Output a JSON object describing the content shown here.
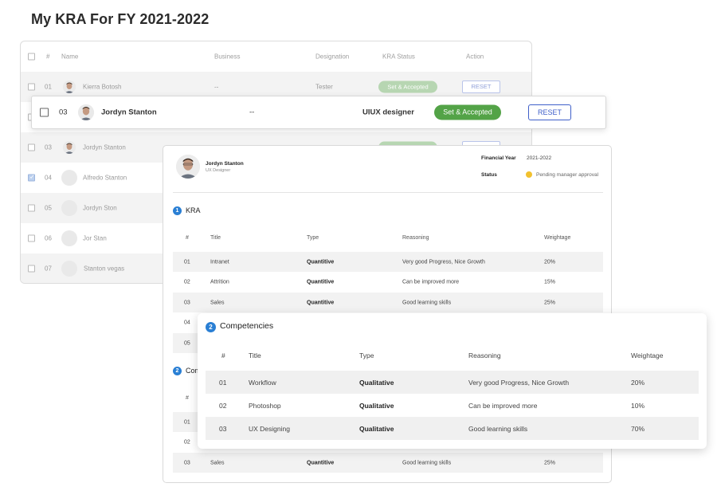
{
  "page": {
    "title": "My KRA For FY 2021-2022"
  },
  "list": {
    "headers": {
      "num": "#",
      "name": "Name",
      "business": "Business",
      "designation": "Designation",
      "status": "KRA Status",
      "action": "Action"
    },
    "rows": [
      {
        "num": "01",
        "name": "Kierra Botosh",
        "business": "--",
        "designation": "Tester",
        "status": "Set & Accepted",
        "action": "RESET"
      },
      {
        "num": "03",
        "name": "Jordyn Stanton"
      },
      {
        "num": "04",
        "name": "Alfredo Stanton"
      },
      {
        "num": "05",
        "name": "Jordyn Ston"
      },
      {
        "num": "06",
        "name": "Jor Stan"
      },
      {
        "num": "07",
        "name": "Stanton vegas"
      }
    ]
  },
  "highlight_row": {
    "num": "03",
    "name": "Jordyn Stanton",
    "business": "--",
    "designation": "UIUX designer",
    "status": "Set & Accepted",
    "action": "RESET"
  },
  "detail": {
    "profile": {
      "name": "Jordyn Stanton",
      "role": "UX Designer"
    },
    "financial_year_label": "Financial Year",
    "financial_year": "2021-2022",
    "status_label": "Status",
    "status_value": "Pending manager approval",
    "status_color": "#f2c12e",
    "kra_section": {
      "number": "1",
      "title": "KRA"
    },
    "kra_headers": {
      "num": "#",
      "title": "Title",
      "type": "Type",
      "reasoning": "Reasoning",
      "weightage": "Weightage"
    },
    "kra_rows": [
      {
        "num": "01",
        "title": "Intranet",
        "type": "Quantitive",
        "reasoning": "Very good Progress, Nice Growth",
        "weightage": "20%"
      },
      {
        "num": "02",
        "title": "Attrition",
        "type": "Quantitive",
        "reasoning": "Can be improved more",
        "weightage": "15%"
      },
      {
        "num": "03",
        "title": "Sales",
        "type": "Quantitive",
        "reasoning": "Good learning skills",
        "weightage": "25%"
      },
      {
        "num": "04"
      },
      {
        "num": "05"
      }
    ],
    "comp_section_partial": {
      "number": "2",
      "title": "Com"
    },
    "partial_rows": [
      {
        "num": "#"
      },
      {
        "num": "01"
      },
      {
        "num": "02"
      },
      {
        "num": "03",
        "title": "Sales",
        "type": "Quantitive",
        "reasoning": "Good learning skills",
        "weightage": "25%"
      }
    ]
  },
  "competencies": {
    "number": "2",
    "title": "Competencies",
    "headers": {
      "num": "#",
      "title": "Title",
      "type": "Type",
      "reasoning": "Reasoning",
      "weightage": "Weightage"
    },
    "rows": [
      {
        "num": "01",
        "title": "Workflow",
        "type": "Qualitative",
        "reasoning": "Very good Progress, Nice Growth",
        "weightage": "20%"
      },
      {
        "num": "02",
        "title": "Photoshop",
        "type": "Qualitative",
        "reasoning": "Can be improved more",
        "weightage": "10%"
      },
      {
        "num": "03",
        "title": "UX Designing",
        "type": "Qualitative",
        "reasoning": "Good learning skills",
        "weightage": "70%"
      }
    ]
  },
  "colors": {
    "accent_blue": "#2a7fd4",
    "accepted_green": "#53a347",
    "reset_blue": "#3f5fc9"
  }
}
